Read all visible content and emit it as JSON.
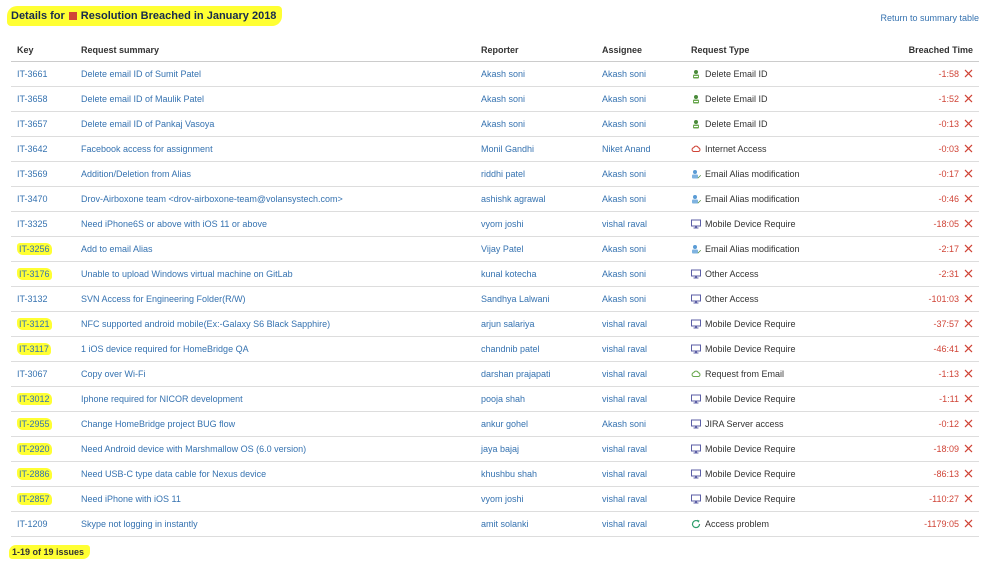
{
  "header": {
    "title_prefix": "Details for",
    "title_suffix": "Resolution Breached in January 2018",
    "status_color": "#d04437",
    "return_link": "Return to summary table"
  },
  "columns": {
    "key": "Key",
    "summary": "Request summary",
    "reporter": "Reporter",
    "assignee": "Assignee",
    "type": "Request Type",
    "breached": "Breached Time"
  },
  "rows": [
    {
      "key": "IT-3661",
      "summary": "Delete email ID of Sumit Patel",
      "reporter": "Akash soni",
      "assignee": "Akash soni",
      "type": "Delete Email ID",
      "icon": "person-delete-icon",
      "breached": "-1:58",
      "highlight": false
    },
    {
      "key": "IT-3658",
      "summary": "Delete email ID of Maulik Patel",
      "reporter": "Akash soni",
      "assignee": "Akash soni",
      "type": "Delete Email ID",
      "icon": "person-delete-icon",
      "breached": "-1:52",
      "highlight": false
    },
    {
      "key": "IT-3657",
      "summary": "Delete email ID of Pankaj Vasoya",
      "reporter": "Akash soni",
      "assignee": "Akash soni",
      "type": "Delete Email ID",
      "icon": "person-delete-icon",
      "breached": "-0:13",
      "highlight": false
    },
    {
      "key": "IT-3642",
      "summary": "Facebook access for assignment",
      "reporter": "Monil Gandhi",
      "assignee": "Niket Anand",
      "type": "Internet Access",
      "icon": "cloud-icon",
      "breached": "-0:03",
      "highlight": false
    },
    {
      "key": "IT-3569",
      "summary": "Addition/Deletion from Alias",
      "reporter": "riddhi patel",
      "assignee": "Akash soni",
      "type": "Email Alias modification",
      "icon": "person-edit-icon",
      "breached": "-0:17",
      "highlight": false
    },
    {
      "key": "IT-3470",
      "summary": "Drov-Airboxone team <drov-airboxone-team@volansystech.com>",
      "reporter": "ashishk agrawal",
      "assignee": "Akash soni",
      "type": "Email Alias modification",
      "icon": "person-edit-icon",
      "breached": "-0:46",
      "highlight": false
    },
    {
      "key": "IT-3325",
      "summary": "Need iPhone6S or above with iOS 11 or above",
      "reporter": "vyom joshi",
      "assignee": "vishal raval",
      "type": "Mobile Device Require",
      "icon": "monitor-icon",
      "breached": "-18:05",
      "highlight": false
    },
    {
      "key": "IT-3256",
      "summary": "Add to email Alias",
      "reporter": "Vijay Patel",
      "assignee": "Akash soni",
      "type": "Email Alias modification",
      "icon": "person-edit-icon",
      "breached": "-2:17",
      "highlight": true
    },
    {
      "key": "IT-3176",
      "summary": "Unable to upload Windows virtual machine on GitLab",
      "reporter": "kunal kotecha",
      "assignee": "Akash soni",
      "type": "Other Access",
      "icon": "monitor-icon",
      "breached": "-2:31",
      "highlight": true
    },
    {
      "key": "IT-3132",
      "summary": "SVN Access for Engineering Folder(R/W)",
      "reporter": "Sandhya Lalwani",
      "assignee": "Akash soni",
      "type": "Other Access",
      "icon": "monitor-icon",
      "breached": "-101:03",
      "highlight": false
    },
    {
      "key": "IT-3121",
      "summary": "NFC supported android mobile(Ex:-Galaxy S6 Black Sapphire)",
      "reporter": "arjun salariya",
      "assignee": "vishal raval",
      "type": "Mobile Device Require",
      "icon": "monitor-icon",
      "breached": "-37:57",
      "highlight": true
    },
    {
      "key": "IT-3117",
      "summary": "1 iOS device required for HomeBridge QA",
      "reporter": "chandnib patel",
      "assignee": "vishal raval",
      "type": "Mobile Device Require",
      "icon": "monitor-icon",
      "breached": "-46:41",
      "highlight": true
    },
    {
      "key": "IT-3067",
      "summary": "Copy over Wi-Fi",
      "reporter": "darshan prajapati",
      "assignee": "vishal raval",
      "type": "Request from Email",
      "icon": "email-cloud-icon",
      "breached": "-1:13",
      "highlight": false
    },
    {
      "key": "IT-3012",
      "summary": "Iphone required for NICOR development",
      "reporter": "pooja shah",
      "assignee": "vishal raval",
      "type": "Mobile Device Require",
      "icon": "monitor-icon",
      "breached": "-1:11",
      "highlight": true
    },
    {
      "key": "IT-2955",
      "summary": "Change HomeBridge project BUG flow",
      "reporter": "ankur gohel",
      "assignee": "Akash soni",
      "type": "JIRA Server access",
      "icon": "monitor-icon",
      "breached": "-0:12",
      "highlight": true
    },
    {
      "key": "IT-2920",
      "summary": "Need Android device with Marshmallow OS (6.0 version)",
      "reporter": "jaya bajaj",
      "assignee": "vishal raval",
      "type": "Mobile Device Require",
      "icon": "monitor-icon",
      "breached": "-18:09",
      "highlight": true
    },
    {
      "key": "IT-2886",
      "summary": "Need USB-C type data cable for Nexus device",
      "reporter": "khushbu shah",
      "assignee": "vishal raval",
      "type": "Mobile Device Require",
      "icon": "monitor-icon",
      "breached": "-86:13",
      "highlight": true
    },
    {
      "key": "IT-2857",
      "summary": "Need iPhone with iOS 11",
      "reporter": "vyom joshi",
      "assignee": "vishal raval",
      "type": "Mobile Device Require",
      "icon": "monitor-icon",
      "breached": "-110:27",
      "highlight": true
    },
    {
      "key": "IT-1209",
      "summary": "Skype not logging in instantly",
      "reporter": "amit solanki",
      "assignee": "vishal raval",
      "type": "Access problem",
      "icon": "refresh-icon",
      "breached": "-1179:05",
      "highlight": false
    }
  ],
  "footer": {
    "issues_count": "1-19 of 19 issues"
  }
}
